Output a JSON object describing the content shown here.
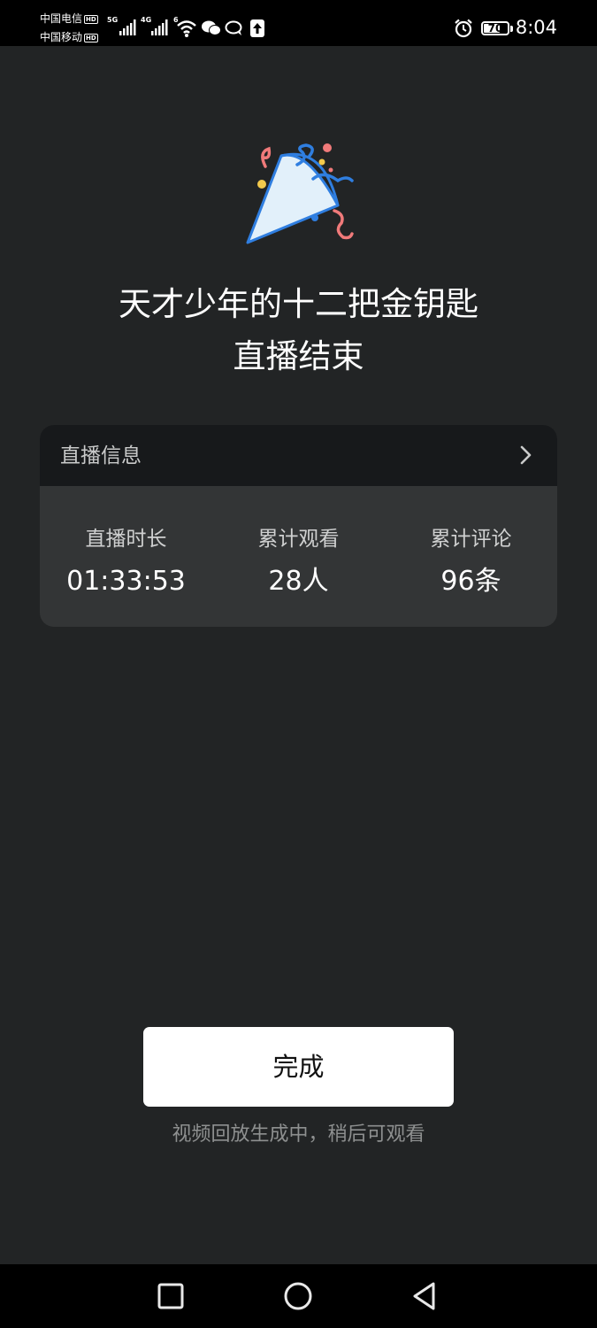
{
  "status_bar": {
    "carrier1": "中国电信",
    "carrier2": "中国移动",
    "hd_badge": "HD",
    "sim1_network": "5G",
    "sim2_network": "4G",
    "wifi_network": "6",
    "battery": "70",
    "battery_fraction": 0.7,
    "time": "8:04",
    "icons": [
      "signal-icon",
      "wifi-icon",
      "wechat-icon",
      "message-icon",
      "upload-icon",
      "alarm-icon",
      "battery-icon"
    ]
  },
  "header": {
    "title_line1": "天才少年的十二把金钥匙",
    "title_line2": "直播结束"
  },
  "info_card": {
    "header_label": "直播信息",
    "stats": [
      {
        "label": "直播时长",
        "value": "01:33:53"
      },
      {
        "label": "累计观看",
        "value": "28人"
      },
      {
        "label": "累计评论",
        "value": "96条"
      }
    ]
  },
  "footer": {
    "done_label": "完成",
    "hint": "视频回放生成中，稍后可观看"
  },
  "nav_bar": {
    "icons": [
      "recent-apps-icon",
      "home-icon",
      "back-icon"
    ]
  },
  "colors": {
    "background": "#222425",
    "card": "#333536",
    "card_header": "#17191b",
    "confetti_blue": "#2f7ee0",
    "confetti_pink": "#f07a7a",
    "confetti_yellow": "#f2c94c"
  }
}
